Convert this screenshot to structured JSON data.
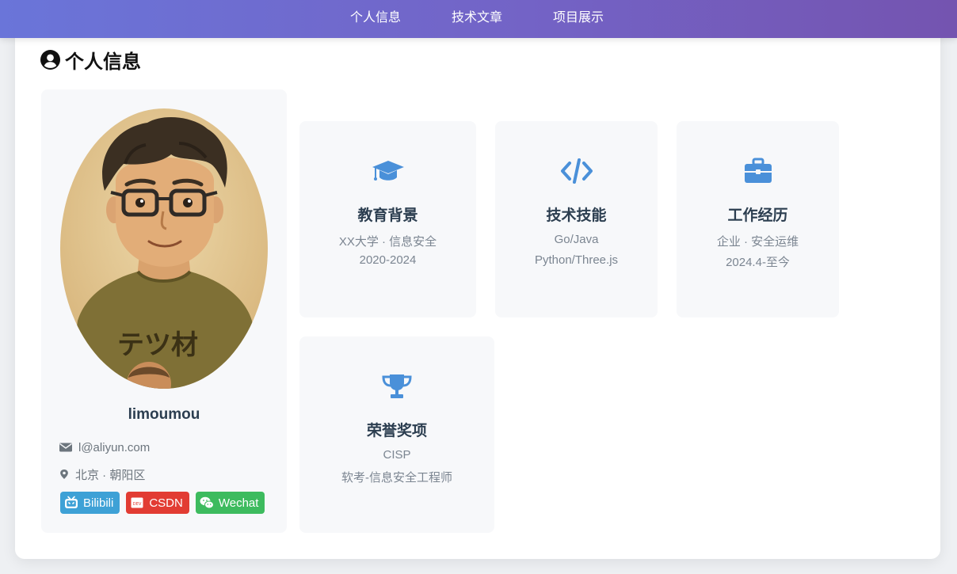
{
  "nav": {
    "items": [
      "个人信息",
      "技术文章",
      "项目展示"
    ]
  },
  "section": {
    "title": "个人信息",
    "icon": "user-circle-icon"
  },
  "profile": {
    "avatar_icon": "avatar-illustration",
    "avatar_shirt_text": "テツ材",
    "name": "limoumou",
    "email": "l@aliyun.com",
    "location": "北京 · 朝阳区",
    "social": [
      {
        "label": "Bilibili",
        "color": "#3ea1d6",
        "icon": "bilibili-icon"
      },
      {
        "label": "CSDN",
        "color": "#e23c33",
        "icon": "csdn-icon"
      },
      {
        "label": "Wechat",
        "color": "#3dbb5e",
        "icon": "wechat-icon"
      }
    ]
  },
  "cards": [
    {
      "title": "教育背景",
      "icon": "graduation-cap-icon",
      "lines": [
        "XX大学 · 信息安全",
        "2020-2024"
      ]
    },
    {
      "title": "技术技能",
      "icon": "code-icon",
      "lines": [
        "Go/Java",
        "Python/Three.js"
      ]
    },
    {
      "title": "工作经历",
      "icon": "briefcase-icon",
      "lines": [
        "企业 · 安全运维",
        "2024.4-至今"
      ]
    },
    {
      "title": "荣誉奖项",
      "icon": "trophy-icon",
      "lines": [
        "CISP",
        "软考-信息安全工程师"
      ]
    }
  ],
  "colors": {
    "accent": "#4a90d9",
    "nav_start": "#6a75d9",
    "nav_end": "#7454b0"
  }
}
